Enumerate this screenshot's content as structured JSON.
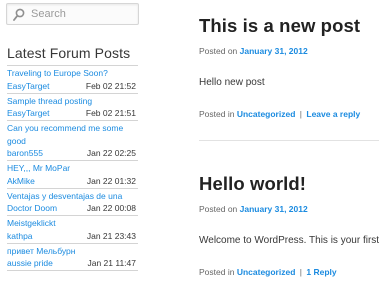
{
  "search": {
    "placeholder": "Search",
    "icon": "search-icon"
  },
  "sidebar": {
    "widget_title": "Latest Forum Posts",
    "forum_posts": [
      {
        "thread": "Traveling to Europe Soon?",
        "author": "EasyTarget",
        "date": "Feb 02 21:52"
      },
      {
        "thread": "Sample thread posting",
        "author": "EasyTarget",
        "date": "Feb 02 21:51"
      },
      {
        "thread": "Can you recommend me some good",
        "author": "baron555",
        "date": "Jan 22 02:25"
      },
      {
        "thread": "HEY,,, Mr MoPar",
        "author": "AkMike",
        "date": "Jan 22 01:32"
      },
      {
        "thread": "Ventajas y desventajas de una",
        "author": "Doctor Doom",
        "date": "Jan 22 00:08"
      },
      {
        "thread": "Meistgeklickt",
        "author": "kathpa",
        "date": "Jan 21 23:43"
      },
      {
        "thread": "привет Мельбурн",
        "author": "aussie pride",
        "date": "Jan 21 11:47"
      }
    ]
  },
  "posts": [
    {
      "title": "This is a new post",
      "posted_on_label": "Posted on",
      "date": "January 31, 2012",
      "content": "Hello new post",
      "posted_in_label": "Posted in",
      "category": "Uncategorized",
      "separator": "|",
      "reply_link": "Leave a reply"
    },
    {
      "title": "Hello world!",
      "posted_on_label": "Posted on",
      "date": "January 31, 2012",
      "content": "Welcome to WordPress. This is your first post.",
      "posted_in_label": "Posted in",
      "category": "Uncategorized",
      "separator": "|",
      "reply_link": "1 Reply"
    }
  ],
  "colors": {
    "link": "#1b8be0",
    "text": "#373737",
    "title": "#222222"
  }
}
